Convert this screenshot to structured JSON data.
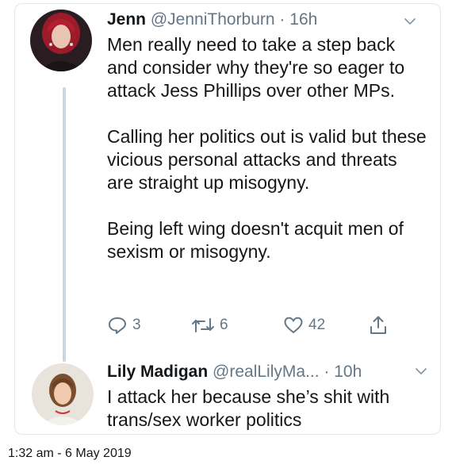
{
  "tweets": [
    {
      "display_name": "Jenn",
      "handle": "@JenniThorburn",
      "separator": " · ",
      "time": "16h",
      "paragraphs": [
        "Men really need to take a step back and consider why they're so eager to attack Jess Phillips over other MPs.",
        "Calling her politics out is valid but these vicious personal attacks and threats are straight up misogyny.",
        "Being left wing doesn't acquit men of sexism or misogyny."
      ],
      "actions": {
        "replies": "3",
        "retweets": "6",
        "likes": "42"
      }
    },
    {
      "display_name": "Lily Madigan",
      "handle": "@realLilyMa...",
      "separator": " · ",
      "time": "10h",
      "paragraphs": [
        "I attack her because she’s shit with trans/sex worker politics"
      ]
    }
  ],
  "timestamp": "1:32 am - 6 May 2019",
  "colors": {
    "text": "#14171a",
    "muted": "#657786",
    "thread_line": "#ccd6dd",
    "border": "#e1e8ed"
  }
}
